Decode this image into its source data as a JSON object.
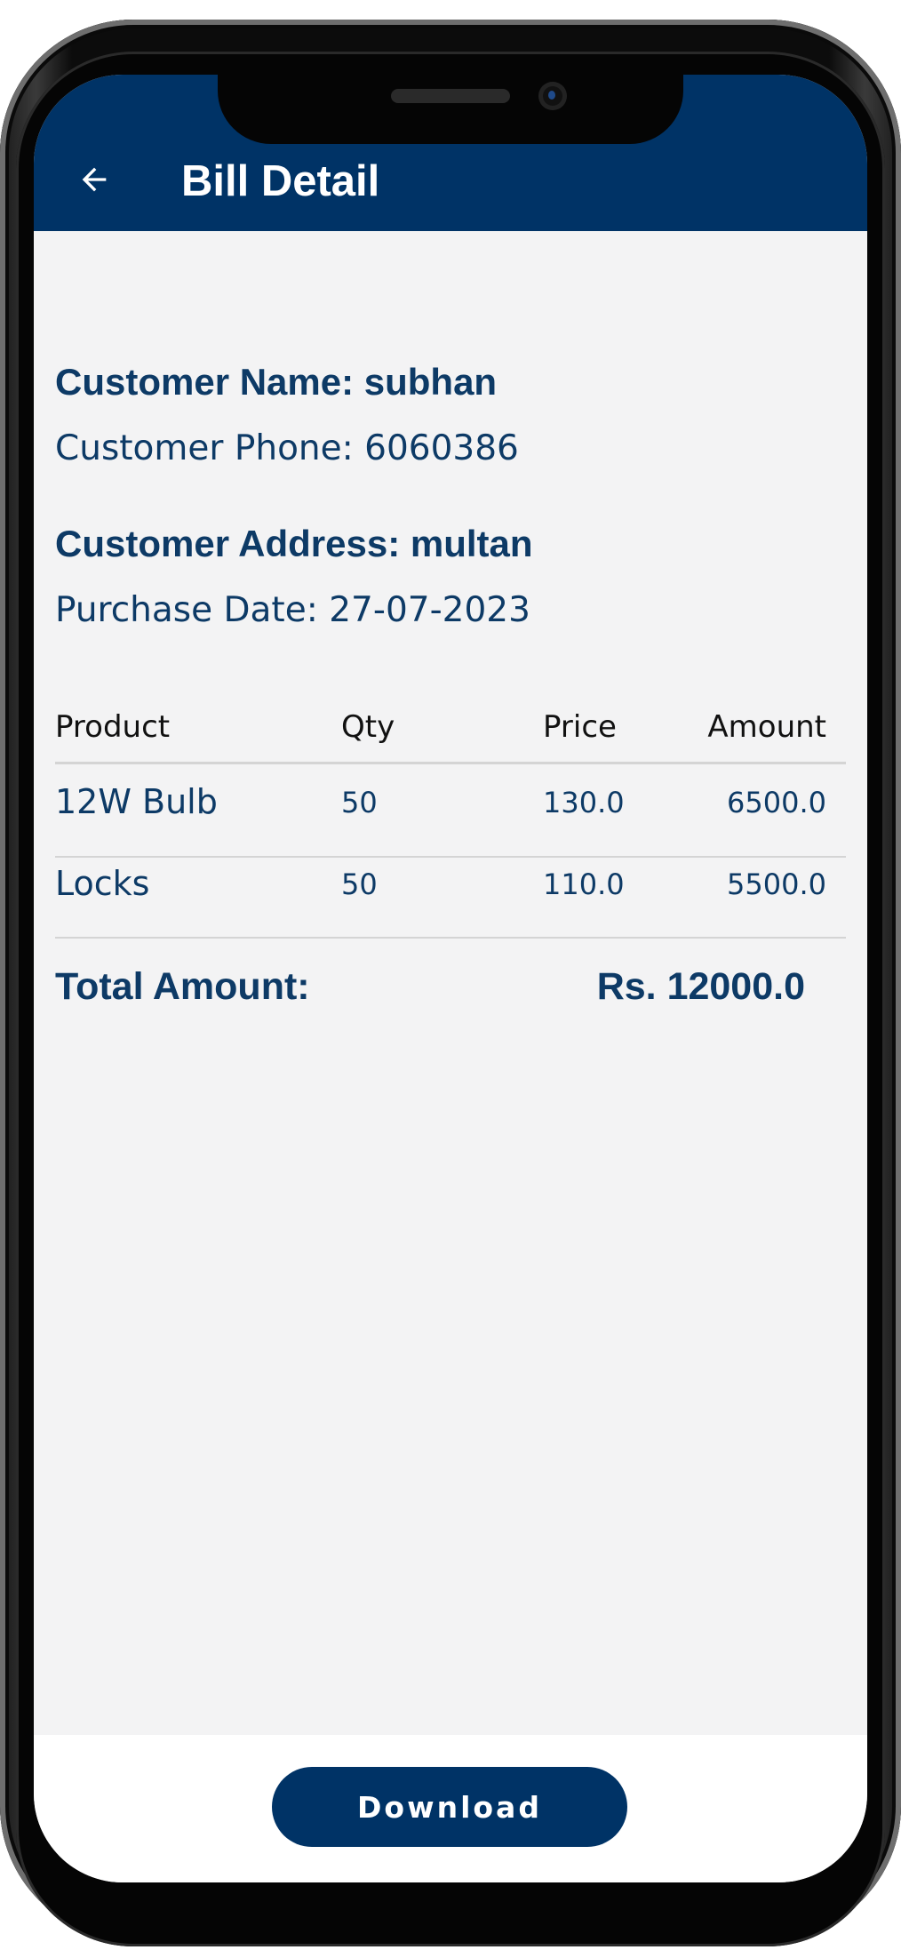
{
  "appbar": {
    "title": "Bill Detail",
    "back_icon": "arrow-left-icon",
    "color": "#003366"
  },
  "customer": {
    "name_line": "Customer Name: subhan",
    "phone_line": "Customer Phone: 6060386",
    "address_line": "Customer Address: multan",
    "date_line": "Purchase Date: 27-07-2023"
  },
  "table": {
    "headers": {
      "product": "Product",
      "qty": "Qty",
      "price": "Price",
      "amount": "Amount"
    },
    "rows": [
      {
        "product": "12W Bulb",
        "qty": "50",
        "price": "130.0",
        "amount": "6500.0"
      },
      {
        "product": "Locks",
        "qty": "50",
        "price": "110.0",
        "amount": "5500.0"
      }
    ]
  },
  "total": {
    "label": "Total Amount:",
    "value": "Rs. 12000.0"
  },
  "footer": {
    "download_label": "Download"
  }
}
